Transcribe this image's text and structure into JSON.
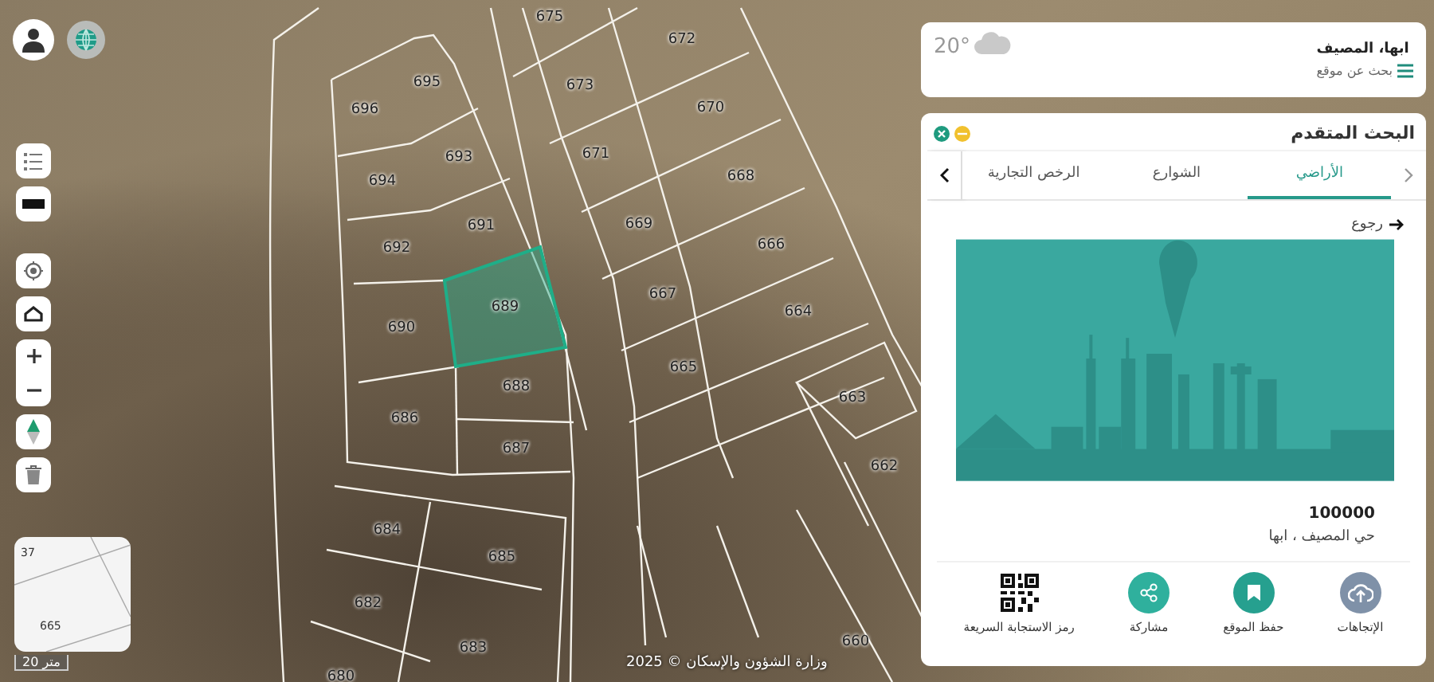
{
  "map": {
    "parcels": [
      {
        "label": "675",
        "selected": false
      },
      {
        "label": "672",
        "selected": false
      },
      {
        "label": "695",
        "selected": false
      },
      {
        "label": "673",
        "selected": false
      },
      {
        "label": "696",
        "selected": false
      },
      {
        "label": "670",
        "selected": false
      },
      {
        "label": "693",
        "selected": false
      },
      {
        "label": "671",
        "selected": false
      },
      {
        "label": "694",
        "selected": false
      },
      {
        "label": "668",
        "selected": false
      },
      {
        "label": "691",
        "selected": false
      },
      {
        "label": "669",
        "selected": false
      },
      {
        "label": "692",
        "selected": false
      },
      {
        "label": "666",
        "selected": false
      },
      {
        "label": "667",
        "selected": false
      },
      {
        "label": "689",
        "selected": true
      },
      {
        "label": "690",
        "selected": false
      },
      {
        "label": "664",
        "selected": false
      },
      {
        "label": "665",
        "selected": false
      },
      {
        "label": "688",
        "selected": false
      },
      {
        "label": "663",
        "selected": false
      },
      {
        "label": "686",
        "selected": false
      },
      {
        "label": "687",
        "selected": false
      },
      {
        "label": "662",
        "selected": false
      },
      {
        "label": "684",
        "selected": false
      },
      {
        "label": "685",
        "selected": false
      },
      {
        "label": "682",
        "selected": false
      },
      {
        "label": "683",
        "selected": false
      },
      {
        "label": "680",
        "selected": false
      },
      {
        "label": "660",
        "selected": false
      }
    ],
    "minimap": {
      "labels": [
        "37",
        "665"
      ]
    },
    "scale": "20 متر",
    "attribution": "وزارة الشؤون والإسكان © 2025"
  },
  "weather": {
    "temperature": "20°",
    "location": "ابها، المصيف",
    "search_label": "بحث عن موقع"
  },
  "panel": {
    "title": "البحث المتقدم",
    "tabs": [
      {
        "label": "الأراضي",
        "selected": true
      },
      {
        "label": "الشوارع",
        "selected": false
      },
      {
        "label": "الرخص التجارية",
        "selected": false
      }
    ],
    "back": "رجوع",
    "result": {
      "number": "100000",
      "address": "حي المصيف ، ابها"
    },
    "actions": [
      {
        "label": "الإتجاهات",
        "kind": "directions"
      },
      {
        "label": "حفظ الموقع",
        "kind": "save"
      },
      {
        "label": "مشاركة",
        "kind": "share"
      },
      {
        "label": "رمز الاستجابة السريعة",
        "kind": "qr"
      }
    ]
  }
}
